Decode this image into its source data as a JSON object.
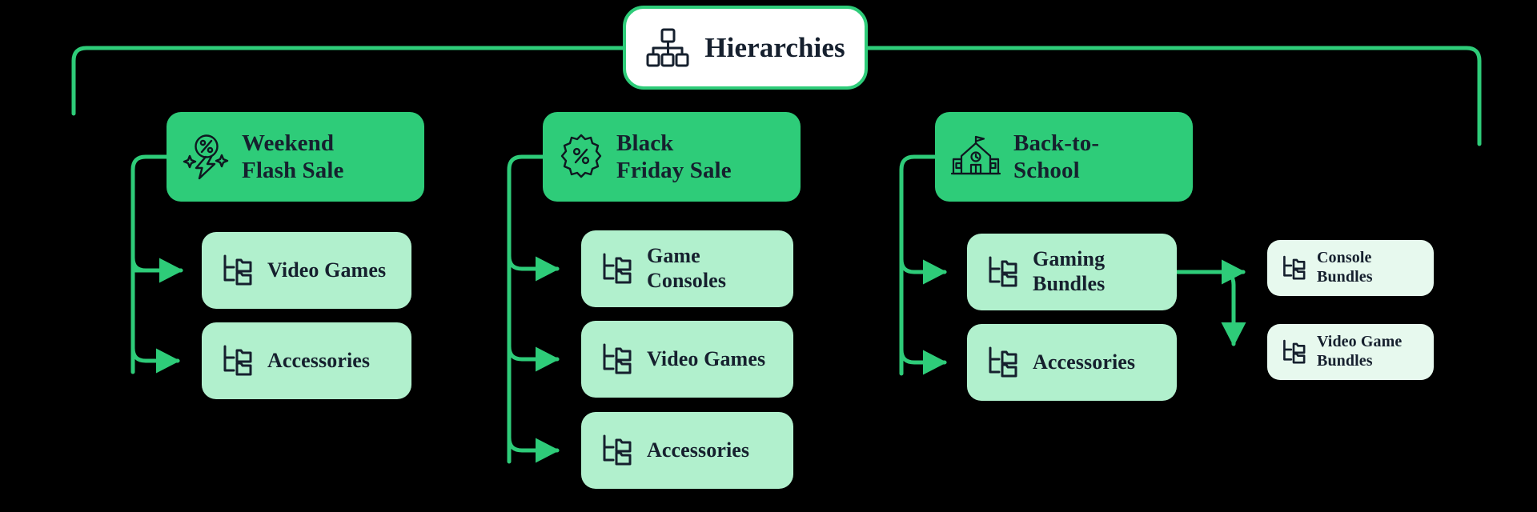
{
  "diagram": {
    "title": "Hierarchies",
    "root_icon": "org-chart-icon",
    "colors": {
      "background": "#000000",
      "accent_green": "#2ecc79",
      "level1_fill": "#2ecc79",
      "level2_fill": "#b1f0cd",
      "level3_fill": "#e7f9ee",
      "root_fill": "#ffffff",
      "text_dark": "#16202e"
    }
  },
  "groups": [
    {
      "id": "weekend-flash-sale",
      "label": "Weekend\nFlash Sale",
      "icon": "flash-discount-icon",
      "children": [
        {
          "id": "wk-video-games",
          "label": "Video Games",
          "icon": "folder-tree-icon"
        },
        {
          "id": "wk-accessories",
          "label": "Accessories",
          "icon": "folder-tree-icon"
        }
      ]
    },
    {
      "id": "black-friday-sale",
      "label": "Black\nFriday Sale",
      "icon": "discount-badge-icon",
      "children": [
        {
          "id": "bf-game-consoles",
          "label": "Game\nConsoles",
          "icon": "folder-tree-icon"
        },
        {
          "id": "bf-video-games",
          "label": "Video Games",
          "icon": "folder-tree-icon"
        },
        {
          "id": "bf-accessories",
          "label": "Accessories",
          "icon": "folder-tree-icon"
        }
      ]
    },
    {
      "id": "back-to-school",
      "label": "Back-to-\nSchool",
      "icon": "school-building-icon",
      "children": [
        {
          "id": "bs-gaming-bundles",
          "label": "Gaming\nBundles",
          "icon": "folder-tree-icon",
          "children": [
            {
              "id": "console-bundles",
              "label": "Console\nBundles",
              "icon": "folder-tree-icon"
            },
            {
              "id": "video-game-bundles",
              "label": "Video Game\nBundles",
              "icon": "folder-tree-icon"
            }
          ]
        },
        {
          "id": "bs-accessories",
          "label": "Accessories",
          "icon": "folder-tree-icon"
        }
      ]
    }
  ]
}
